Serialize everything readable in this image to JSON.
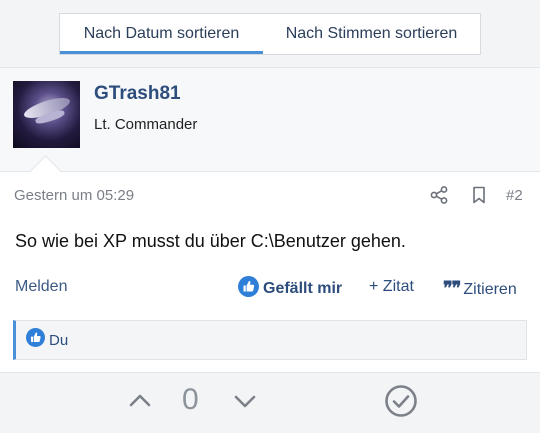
{
  "sort_tabs": {
    "by_date": "Nach Datum sortieren",
    "by_votes": "Nach Stimmen sortieren"
  },
  "post": {
    "author": {
      "name": "GTrash81",
      "rank": "Lt. Commander"
    },
    "date": "Gestern um 05:29",
    "number": "#2",
    "body": "So wie bei XP musst du über C:\\Benutzer gehen.",
    "actions": {
      "report": "Melden",
      "like": "Gefällt mir",
      "quote_add": "+ Zitat",
      "quote": "Zitieren"
    },
    "reactions": {
      "users": "Du"
    }
  },
  "vote": {
    "count": "0"
  },
  "colors": {
    "accent": "#4a90d9",
    "link": "#2d4d7c",
    "muted": "#7a7f87"
  },
  "icons": [
    "share-icon",
    "bookmark-icon",
    "like-icon",
    "quote-icon",
    "chevron-up-icon",
    "chevron-down-icon",
    "check-circle-icon"
  ]
}
